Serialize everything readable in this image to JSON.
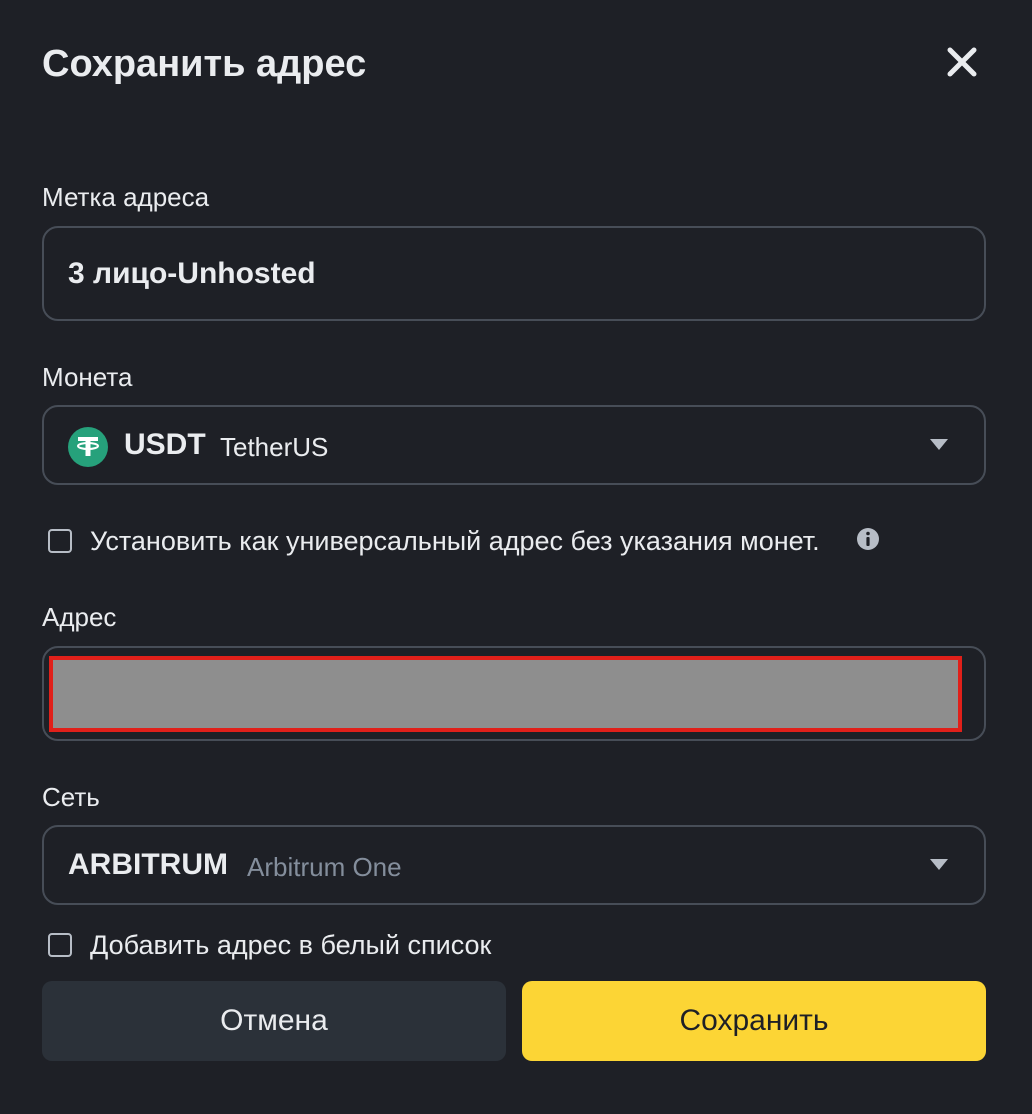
{
  "dialog": {
    "title": "Сохранить адрес"
  },
  "label_field": {
    "label": "Метка адреса",
    "value": "3 лицо-Unhosted"
  },
  "coin": {
    "label": "Монета",
    "symbol": "USDT",
    "name": "TetherUS",
    "icon": "tether-icon",
    "icon_color": "#26a17b"
  },
  "universal_option": {
    "label": "Установить как универсальный адрес без указания монет.",
    "checked": false
  },
  "address": {
    "label": "Адрес",
    "value": ""
  },
  "network": {
    "label": "Сеть",
    "code": "ARBITRUM",
    "name": "Arbitrum One"
  },
  "whitelist_option": {
    "label": "Добавить адрес в белый список",
    "checked": false
  },
  "buttons": {
    "cancel": "Отмена",
    "save": "Сохранить"
  },
  "colors": {
    "background": "#1e2026",
    "accent": "#fcd535",
    "border": "#474d57",
    "secondary_button": "#2b3139",
    "redaction": "#8e8e8e",
    "redaction_border": "#e0201a"
  }
}
